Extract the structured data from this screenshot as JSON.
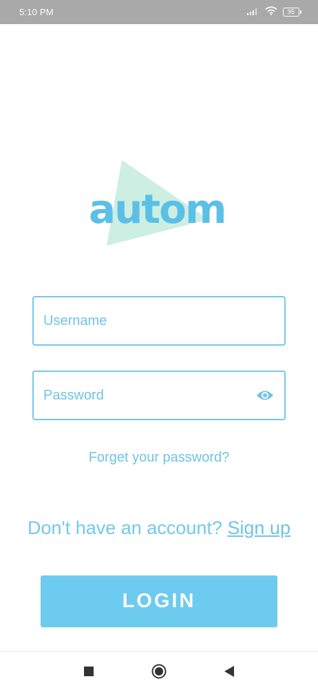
{
  "status_bar": {
    "time": "5:10 PM",
    "battery_level": "95",
    "icons": [
      "signal-icon",
      "wifi-icon",
      "battery-icon"
    ]
  },
  "logo": {
    "text": "autom",
    "colors": {
      "text": "#5bc0e6",
      "triangle": "#cdeee2"
    }
  },
  "login_form": {
    "username_placeholder": "Username",
    "username_value": "",
    "password_placeholder": "Password",
    "password_value": "",
    "forgot_password_label": "Forget your password?",
    "signup_prompt": "Don't have an account?",
    "signup_link": "Sign up",
    "login_button": "LOGIN"
  },
  "nav_bar": {
    "buttons": [
      "recents-square-icon",
      "home-circle-icon",
      "back-triangle-icon"
    ]
  },
  "colors": {
    "accent": "#6ccbef",
    "border": "#74c9ea",
    "status_bar_bg": "#a9a9a9"
  }
}
